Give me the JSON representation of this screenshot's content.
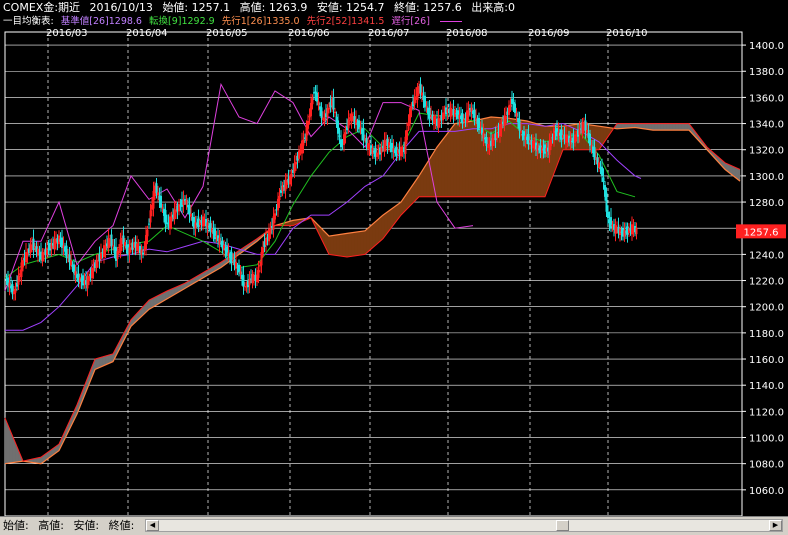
{
  "header": {
    "symbol": "COMEX金:期近",
    "date": "2016/10/13",
    "open": "始値: 1257.1",
    "high": "高値: 1263.9",
    "low": "安値: 1254.7",
    "close": "終値: 1257.6",
    "volume": "出来高:0"
  },
  "legend": {
    "title": "一目均衡表:",
    "items": [
      {
        "text": "基準値[26]1298.6",
        "color": "#a040ff"
      },
      {
        "text": "転換[9]1292.9",
        "color": "#20c020"
      },
      {
        "text": "先行1[26]1335.0",
        "color": "#ff8040"
      },
      {
        "text": "先行2[52]1341.5",
        "color": "#ff2020"
      },
      {
        "text": "遅行[26]",
        "color": "#e040e0"
      }
    ]
  },
  "status": {
    "open_label": "始値:",
    "high_label": "高値:",
    "low_label": "安値:",
    "close_label": "終値:"
  },
  "colors": {
    "background": "#000000",
    "cloud_bull": "#7a3a10",
    "cloud_bear": "#707070",
    "span_a": "#ff8040",
    "span_b": "#ff2020",
    "kijun": "#a040ff",
    "tenkan": "#20c020",
    "chikou": "#e040e0",
    "candle_up": "#ff2020",
    "candle_down": "#20e0e0",
    "price_tag": "#ff2020"
  },
  "chart_data": {
    "type": "candlestick-ichimoku",
    "title": "COMEX金:期近",
    "x_ticks": [
      "2016/03",
      "2016/04",
      "2016/05",
      "2016/06",
      "2016/07",
      "2016/08",
      "2016/09",
      "2016/10"
    ],
    "ylim": [
      1040,
      1410
    ],
    "y_ticks": [
      1060.0,
      1080.0,
      1100.0,
      1120.0,
      1140.0,
      1160.0,
      1180.0,
      1200.0,
      1220.0,
      1240.0,
      1260.0,
      1280.0,
      1300.0,
      1320.0,
      1340.0,
      1360.0,
      1380.0,
      1400.0
    ],
    "last_price": "1257.6",
    "grid": true,
    "price_path": [
      [
        0,
        1222
      ],
      [
        6,
        1210
      ],
      [
        12,
        1235
      ],
      [
        18,
        1248
      ],
      [
        24,
        1238
      ],
      [
        30,
        1246
      ],
      [
        36,
        1252
      ],
      [
        42,
        1238
      ],
      [
        48,
        1222
      ],
      [
        54,
        1218
      ],
      [
        60,
        1232
      ],
      [
        66,
        1244
      ],
      [
        70,
        1252
      ],
      [
        74,
        1238
      ],
      [
        78,
        1252
      ],
      [
        82,
        1242
      ],
      [
        86,
        1248
      ],
      [
        92,
        1240
      ],
      [
        100,
        1292
      ],
      [
        104,
        1278
      ],
      [
        108,
        1262
      ],
      [
        114,
        1274
      ],
      [
        120,
        1282
      ],
      [
        126,
        1262
      ],
      [
        132,
        1266
      ],
      [
        138,
        1258
      ],
      [
        144,
        1248
      ],
      [
        150,
        1238
      ],
      [
        156,
        1228
      ],
      [
        160,
        1214
      ],
      [
        164,
        1222
      ],
      [
        168,
        1222
      ],
      [
        172,
        1246
      ],
      [
        178,
        1262
      ],
      [
        184,
        1290
      ],
      [
        190,
        1298
      ],
      [
        196,
        1318
      ],
      [
        200,
        1330
      ],
      [
        206,
        1366
      ],
      [
        212,
        1342
      ],
      [
        218,
        1358
      ],
      [
        224,
        1322
      ],
      [
        230,
        1346
      ],
      [
        236,
        1338
      ],
      [
        242,
        1322
      ],
      [
        248,
        1316
      ],
      [
        254,
        1326
      ],
      [
        260,
        1318
      ],
      [
        266,
        1320
      ],
      [
        270,
        1350
      ],
      [
        276,
        1368
      ],
      [
        282,
        1348
      ],
      [
        288,
        1340
      ],
      [
        294,
        1350
      ],
      [
        300,
        1348
      ],
      [
        306,
        1342
      ],
      [
        310,
        1352
      ],
      [
        316,
        1338
      ],
      [
        322,
        1322
      ],
      [
        328,
        1332
      ],
      [
        334,
        1346
      ],
      [
        338,
        1358
      ],
      [
        344,
        1332
      ],
      [
        350,
        1326
      ],
      [
        356,
        1320
      ],
      [
        362,
        1320
      ],
      [
        366,
        1334
      ],
      [
        372,
        1330
      ],
      [
        378,
        1326
      ],
      [
        386,
        1340
      ],
      [
        392,
        1318
      ],
      [
        398,
        1302
      ],
      [
        402,
        1266
      ],
      [
        406,
        1260
      ],
      [
        412,
        1256
      ],
      [
        418,
        1260
      ],
      [
        421,
        1258
      ]
    ],
    "span_a_path": [
      [
        0,
        1080
      ],
      [
        12,
        1082
      ],
      [
        24,
        1080
      ],
      [
        36,
        1090
      ],
      [
        48,
        1118
      ],
      [
        60,
        1152
      ],
      [
        72,
        1158
      ],
      [
        84,
        1185
      ],
      [
        96,
        1198
      ],
      [
        108,
        1206
      ],
      [
        120,
        1214
      ],
      [
        132,
        1222
      ],
      [
        144,
        1230
      ],
      [
        156,
        1240
      ],
      [
        168,
        1250
      ],
      [
        180,
        1262
      ],
      [
        192,
        1266
      ],
      [
        204,
        1268
      ],
      [
        216,
        1254
      ],
      [
        228,
        1256
      ],
      [
        240,
        1258
      ],
      [
        252,
        1270
      ],
      [
        264,
        1280
      ],
      [
        276,
        1300
      ],
      [
        288,
        1322
      ],
      [
        300,
        1340
      ],
      [
        312,
        1342
      ],
      [
        324,
        1345
      ],
      [
        336,
        1344
      ],
      [
        348,
        1342
      ],
      [
        360,
        1338
      ],
      [
        372,
        1338
      ],
      [
        384,
        1340
      ],
      [
        396,
        1338
      ],
      [
        408,
        1336
      ],
      [
        420,
        1337
      ],
      [
        432,
        1335
      ],
      [
        444,
        1335
      ],
      [
        456,
        1335
      ],
      [
        468,
        1320
      ],
      [
        480,
        1305
      ],
      [
        490,
        1296
      ]
    ],
    "span_b_path": [
      [
        0,
        1115
      ],
      [
        12,
        1082
      ],
      [
        24,
        1085
      ],
      [
        36,
        1095
      ],
      [
        48,
        1125
      ],
      [
        60,
        1160
      ],
      [
        72,
        1164
      ],
      [
        84,
        1190
      ],
      [
        96,
        1205
      ],
      [
        108,
        1212
      ],
      [
        120,
        1218
      ],
      [
        132,
        1226
      ],
      [
        144,
        1234
      ],
      [
        156,
        1243
      ],
      [
        168,
        1252
      ],
      [
        180,
        1262
      ],
      [
        192,
        1262
      ],
      [
        204,
        1268
      ],
      [
        216,
        1240
      ],
      [
        228,
        1238
      ],
      [
        240,
        1240
      ],
      [
        252,
        1252
      ],
      [
        264,
        1270
      ],
      [
        276,
        1284
      ],
      [
        288,
        1284
      ],
      [
        300,
        1284
      ],
      [
        312,
        1284
      ],
      [
        324,
        1284
      ],
      [
        336,
        1284
      ],
      [
        348,
        1284
      ],
      [
        360,
        1284
      ],
      [
        372,
        1320
      ],
      [
        384,
        1320
      ],
      [
        396,
        1320
      ],
      [
        408,
        1340
      ],
      [
        420,
        1340
      ],
      [
        432,
        1340
      ],
      [
        444,
        1340
      ],
      [
        456,
        1340
      ],
      [
        468,
        1322
      ],
      [
        480,
        1310
      ],
      [
        490,
        1305
      ]
    ],
    "kijun_path": [
      [
        0,
        1182
      ],
      [
        12,
        1182
      ],
      [
        24,
        1188
      ],
      [
        36,
        1200
      ],
      [
        48,
        1216
      ],
      [
        60,
        1234
      ],
      [
        72,
        1238
      ],
      [
        84,
        1240
      ],
      [
        96,
        1244
      ],
      [
        108,
        1242
      ],
      [
        120,
        1246
      ],
      [
        132,
        1250
      ],
      [
        144,
        1248
      ],
      [
        156,
        1244
      ],
      [
        168,
        1240
      ],
      [
        180,
        1240
      ],
      [
        192,
        1260
      ],
      [
        204,
        1270
      ],
      [
        216,
        1270
      ],
      [
        228,
        1280
      ],
      [
        240,
        1292
      ],
      [
        252,
        1300
      ],
      [
        264,
        1318
      ],
      [
        276,
        1334
      ],
      [
        288,
        1334
      ],
      [
        300,
        1334
      ],
      [
        312,
        1336
      ],
      [
        324,
        1336
      ],
      [
        336,
        1340
      ],
      [
        348,
        1340
      ],
      [
        360,
        1338
      ],
      [
        372,
        1340
      ],
      [
        384,
        1334
      ],
      [
        396,
        1326
      ],
      [
        408,
        1312
      ],
      [
        420,
        1300
      ],
      [
        424,
        1298
      ]
    ],
    "tenkan_path": [
      [
        0,
        1222
      ],
      [
        12,
        1232
      ],
      [
        24,
        1236
      ],
      [
        36,
        1240
      ],
      [
        48,
        1234
      ],
      [
        60,
        1240
      ],
      [
        72,
        1244
      ],
      [
        84,
        1248
      ],
      [
        96,
        1250
      ],
      [
        108,
        1262
      ],
      [
        120,
        1256
      ],
      [
        132,
        1250
      ],
      [
        144,
        1242
      ],
      [
        156,
        1230
      ],
      [
        168,
        1232
      ],
      [
        180,
        1250
      ],
      [
        192,
        1278
      ],
      [
        204,
        1300
      ],
      [
        216,
        1318
      ],
      [
        228,
        1330
      ],
      [
        240,
        1336
      ],
      [
        252,
        1322
      ],
      [
        264,
        1320
      ],
      [
        276,
        1348
      ],
      [
        288,
        1346
      ],
      [
        300,
        1346
      ],
      [
        312,
        1342
      ],
      [
        324,
        1332
      ],
      [
        336,
        1342
      ],
      [
        348,
        1330
      ],
      [
        360,
        1326
      ],
      [
        372,
        1330
      ],
      [
        384,
        1332
      ],
      [
        396,
        1316
      ],
      [
        408,
        1288
      ],
      [
        420,
        1284
      ]
    ],
    "chikou_path": [
      [
        0,
        1212
      ],
      [
        12,
        1250
      ],
      [
        24,
        1250
      ],
      [
        36,
        1280
      ],
      [
        48,
        1232
      ],
      [
        60,
        1250
      ],
      [
        72,
        1262
      ],
      [
        84,
        1300
      ],
      [
        96,
        1282
      ],
      [
        108,
        1290
      ],
      [
        120,
        1268
      ],
      [
        132,
        1292
      ],
      [
        144,
        1370
      ],
      [
        156,
        1345
      ],
      [
        168,
        1340
      ],
      [
        180,
        1365
      ],
      [
        192,
        1356
      ],
      [
        204,
        1330
      ],
      [
        216,
        1345
      ],
      [
        228,
        1336
      ],
      [
        240,
        1322
      ],
      [
        252,
        1356
      ],
      [
        264,
        1356
      ],
      [
        276,
        1350
      ],
      [
        288,
        1280
      ],
      [
        300,
        1260
      ],
      [
        312,
        1262
      ]
    ]
  }
}
